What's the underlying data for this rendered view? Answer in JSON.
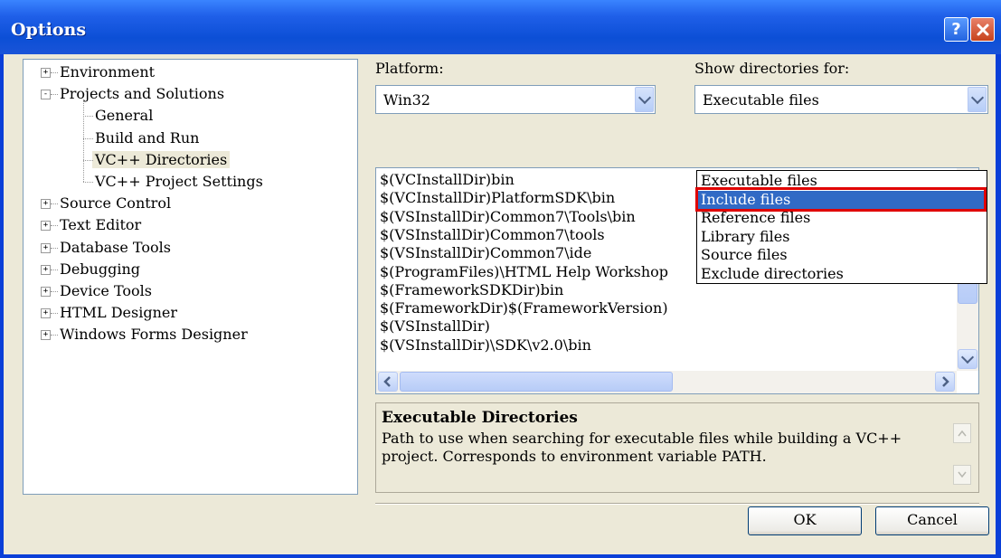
{
  "window": {
    "title": "Options",
    "help_glyph": "?"
  },
  "tree": {
    "items": [
      {
        "label": "Environment",
        "level": 0,
        "expander": "+"
      },
      {
        "label": "Projects and Solutions",
        "level": 0,
        "expander": "-"
      },
      {
        "label": "General",
        "level": 1
      },
      {
        "label": "Build and Run",
        "level": 1
      },
      {
        "label": "VC++ Directories",
        "level": 1,
        "selected": true
      },
      {
        "label": "VC++ Project Settings",
        "level": 1
      },
      {
        "label": "Source Control",
        "level": 0,
        "expander": "+"
      },
      {
        "label": "Text Editor",
        "level": 0,
        "expander": "+"
      },
      {
        "label": "Database Tools",
        "level": 0,
        "expander": "+"
      },
      {
        "label": "Debugging",
        "level": 0,
        "expander": "+"
      },
      {
        "label": "Device Tools",
        "level": 0,
        "expander": "+"
      },
      {
        "label": "HTML Designer",
        "level": 0,
        "expander": "+"
      },
      {
        "label": "Windows Forms Designer",
        "level": 0,
        "expander": "+"
      }
    ]
  },
  "platform": {
    "label": "Platform:",
    "value": "Win32"
  },
  "show_dirs": {
    "label": "Show directories for:",
    "value": "Executable files",
    "options": [
      "Executable files",
      "Include files",
      "Reference files",
      "Library files",
      "Source files",
      "Exclude directories"
    ],
    "highlighted": "Include files"
  },
  "directories": [
    "$(VCInstallDir)bin",
    "$(VCInstallDir)PlatformSDK\\bin",
    "$(VSInstallDir)Common7\\Tools\\bin",
    "$(VSInstallDir)Common7\\tools",
    "$(VSInstallDir)Common7\\ide",
    "$(ProgramFiles)\\HTML Help Workshop",
    "$(FrameworkSDKDir)bin",
    "$(FrameworkDir)$(FrameworkVersion)",
    "$(VSInstallDir)",
    "$(VSInstallDir)\\SDK\\v2.0\\bin"
  ],
  "description": {
    "title": "Executable Directories",
    "body": "Path to use when searching for executable files while building a VC++ project.  Corresponds to environment variable PATH."
  },
  "buttons": {
    "ok": "OK",
    "cancel": "Cancel"
  },
  "colors": {
    "title_bar": "#0c4fd6",
    "selection": "#316ac5",
    "annotation": "#e00000",
    "dialog_bg": "#ece9d8"
  }
}
